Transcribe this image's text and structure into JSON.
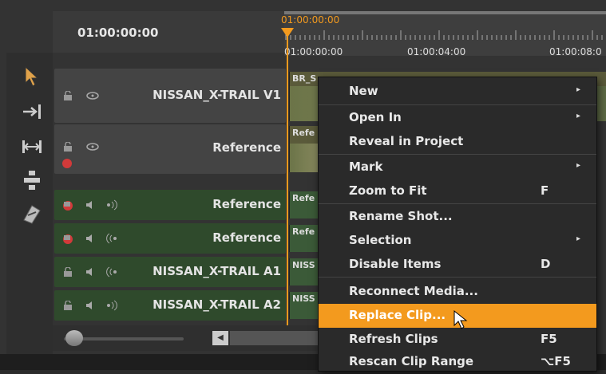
{
  "header": {
    "timecode": "01:00:00:00"
  },
  "ruler": {
    "playhead_timecode": "01:00:00:00",
    "labels": [
      "01:00:00:00",
      "01:00:04:00",
      "01:00:08:0"
    ]
  },
  "tracks": [
    {
      "name": "NISSAN_X-TRAIL V1",
      "type": "video",
      "clip_label": "BR_S",
      "lock_red": false
    },
    {
      "name": "Reference",
      "type": "video",
      "clip_label": "Refe",
      "lock_red": true
    },
    {
      "name": "Reference",
      "type": "audio",
      "clip_label": "Refe",
      "lock_red": true
    },
    {
      "name": "Reference",
      "type": "audio",
      "clip_label": "Refe",
      "lock_red": true
    },
    {
      "name": "NISSAN_X-TRAIL A1",
      "type": "audio",
      "clip_label": "NISS",
      "lock_red": false
    },
    {
      "name": "NISSAN_X-TRAIL A2",
      "type": "audio",
      "clip_label": "NISS",
      "lock_red": false
    }
  ],
  "context_menu": {
    "items": [
      {
        "label": "New",
        "shortcut": "",
        "submenu": true
      },
      {
        "label": "Open In",
        "shortcut": "",
        "submenu": true
      },
      {
        "label": "Reveal in Project",
        "shortcut": "",
        "submenu": false
      },
      {
        "label": "Mark",
        "shortcut": "",
        "submenu": true
      },
      {
        "label": "Zoom to Fit",
        "shortcut": "F",
        "submenu": false
      },
      {
        "label": "Rename Shot...",
        "shortcut": "",
        "submenu": false
      },
      {
        "label": "Selection",
        "shortcut": "",
        "submenu": true
      },
      {
        "label": "Disable Items",
        "shortcut": "D",
        "submenu": false
      },
      {
        "label": "Reconnect Media...",
        "shortcut": "",
        "submenu": false
      },
      {
        "label": "Replace Clip...",
        "shortcut": "",
        "submenu": false,
        "highlighted": true
      },
      {
        "label": "Refresh Clips",
        "shortcut": "F5",
        "submenu": false
      },
      {
        "label": "Rescan Clip Range",
        "shortcut": "⌥F5",
        "submenu": false
      }
    ],
    "highlight_color": "#f39a1e"
  },
  "colors": {
    "accent": "#f39a1e",
    "audio_track": "#2f4a2c",
    "video_track": "#444444"
  }
}
